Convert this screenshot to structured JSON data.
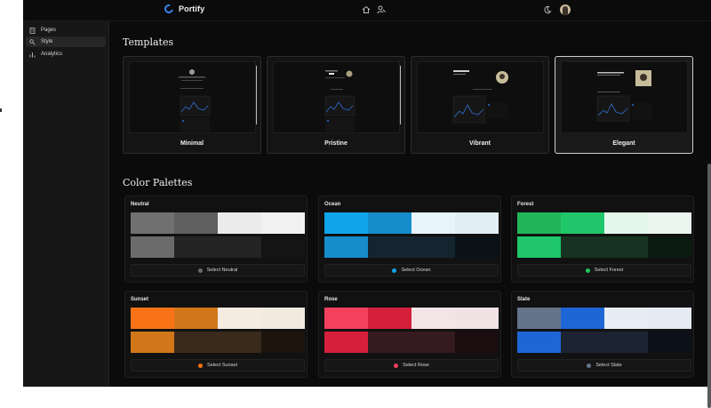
{
  "app": {
    "brand": "Portify"
  },
  "topbar": {
    "icons": [
      "home-icon",
      "user-settings-icon",
      "theme-toggle-icon"
    ]
  },
  "sidebar": {
    "items": [
      {
        "label": "Pages",
        "icon": "pages-icon",
        "active": false
      },
      {
        "label": "Style",
        "icon": "style-icon",
        "active": true
      },
      {
        "label": "Analytics",
        "icon": "analytics-icon",
        "active": false
      }
    ]
  },
  "templates": {
    "heading": "Templates",
    "items": [
      {
        "label": "Minimal",
        "selected": false
      },
      {
        "label": "Pristine",
        "selected": false
      },
      {
        "label": "Vibrant",
        "selected": false
      },
      {
        "label": "Elegant",
        "selected": true
      }
    ]
  },
  "palettes": {
    "heading": "Color Palettes",
    "items": [
      {
        "name": "Neutral",
        "button": "Select Neutral",
        "dot": "#6b6b6b",
        "row1": [
          "#707070",
          "#5f5f5f",
          "#ebebeb",
          "#f2f2f2"
        ],
        "row2": [
          "#6b6b6b",
          "#242424",
          "#242424",
          "#141414"
        ]
      },
      {
        "name": "Ocean",
        "button": "Select Ocean",
        "dot": "#0ea5e9",
        "row1": [
          "#0ea5e9",
          "#168ccb",
          "#e8f4fb",
          "#e2eef6"
        ],
        "row2": [
          "#168ccb",
          "#14252f",
          "#14252f",
          "#0a1218"
        ]
      },
      {
        "name": "Forest",
        "button": "Select Forest",
        "dot": "#22c55e",
        "row1": [
          "#22b559",
          "#20c66a",
          "#e3f7ea",
          "#eaf6ee"
        ],
        "row2": [
          "#20c66a",
          "#163421",
          "#163421",
          "#0b1a10"
        ]
      },
      {
        "name": "Sunset",
        "button": "Select Sunset",
        "dot": "#f97316",
        "row1": [
          "#f97316",
          "#d2761a",
          "#f5ebe1",
          "#f3eadf"
        ],
        "row2": [
          "#d2761a",
          "#3a2a1c",
          "#3a2a1c",
          "#1c140d"
        ]
      },
      {
        "name": "Rose",
        "button": "Select Rose",
        "dot": "#f43f5e",
        "row1": [
          "#f43f5e",
          "#d51f3b",
          "#f3e4e7",
          "#f1e2e5"
        ],
        "row2": [
          "#d51f3b",
          "#351a1f",
          "#351a1f",
          "#1b0c0f"
        ]
      },
      {
        "name": "Slate",
        "button": "Select Slate",
        "dot": "#64748b",
        "row1": [
          "#64748b",
          "#1e66d6",
          "#e8ecf4",
          "#e6eaf2"
        ],
        "row2": [
          "#1e66d6",
          "#1c2433",
          "#1c2433",
          "#0c1019"
        ]
      }
    ]
  }
}
